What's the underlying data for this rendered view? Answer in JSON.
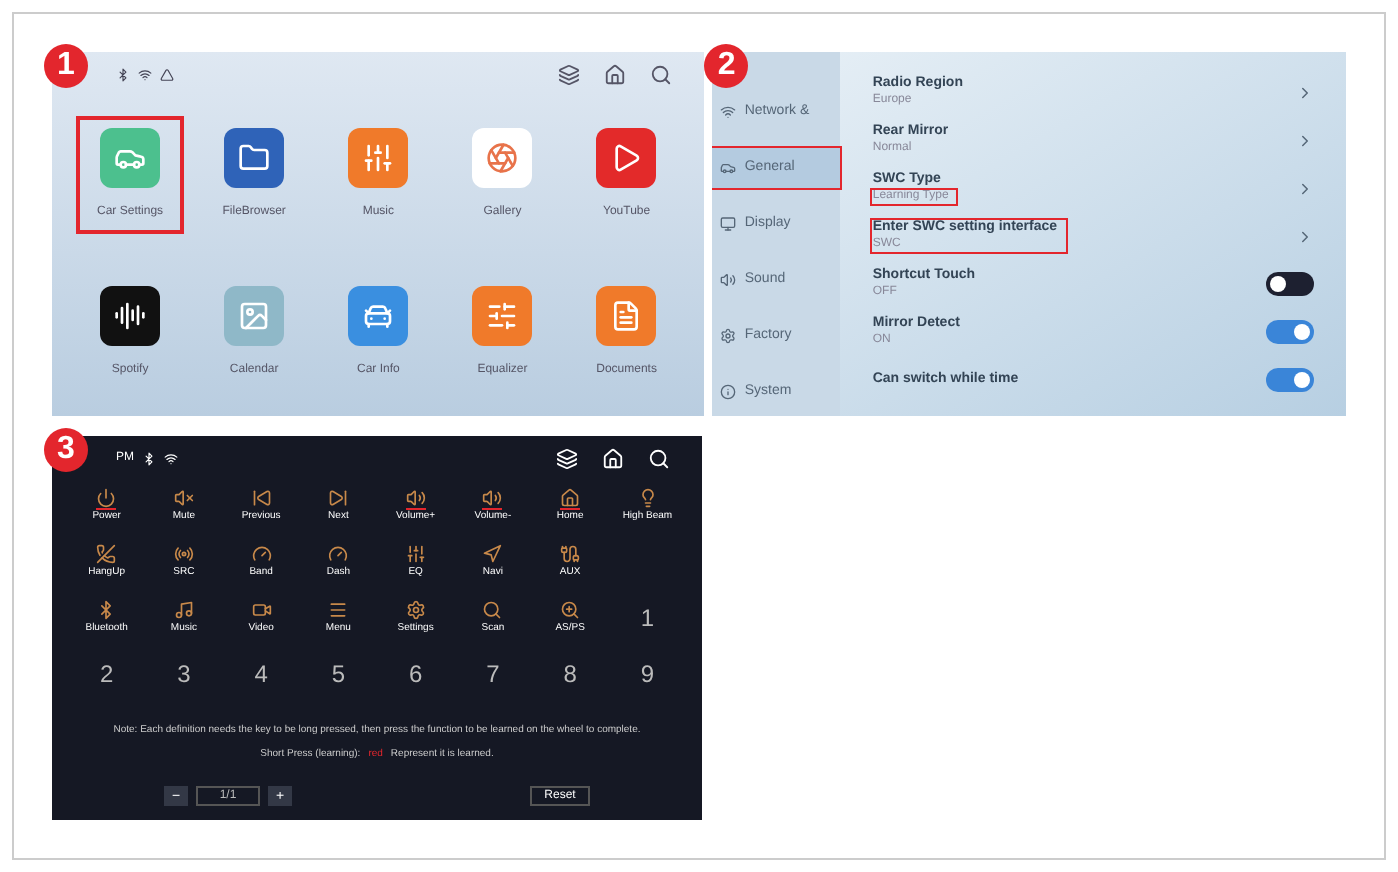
{
  "step_badges": [
    "1",
    "2",
    "3"
  ],
  "home_screen": {
    "apps": [
      {
        "label": "Car Settings",
        "color": "#4cc08e",
        "highlighted": true
      },
      {
        "label": "FileBrowser",
        "color": "#2f63b8",
        "highlighted": false
      },
      {
        "label": "Music",
        "color": "#f07a2a",
        "highlighted": false
      },
      {
        "label": "Gallery",
        "color": "#ffffff",
        "highlighted": false
      },
      {
        "label": "YouTube",
        "color": "#e32a2a",
        "highlighted": false
      },
      {
        "label": "Spotify",
        "color": "#111111",
        "highlighted": false
      },
      {
        "label": "Calendar",
        "color": "#8fb8c8",
        "highlighted": false
      },
      {
        "label": "Car Info",
        "color": "#3a8fe0",
        "highlighted": false
      },
      {
        "label": "Equalizer",
        "color": "#f07a2a",
        "highlighted": false
      },
      {
        "label": "Documents",
        "color": "#f07a2a",
        "highlighted": false
      }
    ]
  },
  "settings_screen": {
    "sidebar": [
      {
        "label": "Network &",
        "selected": false
      },
      {
        "label": "General",
        "selected": true
      },
      {
        "label": "Display",
        "selected": false
      },
      {
        "label": "Sound",
        "selected": false
      },
      {
        "label": "Factory",
        "selected": false
      },
      {
        "label": "System",
        "selected": false
      }
    ],
    "rows": [
      {
        "kind": "link",
        "title": "Radio Region",
        "value": "Europe",
        "row_highlighted": false,
        "value_highlighted": false
      },
      {
        "kind": "link",
        "title": "Rear Mirror",
        "value": "Normal",
        "row_highlighted": false,
        "value_highlighted": false
      },
      {
        "kind": "link",
        "title": "SWC Type",
        "value": "Learning Type",
        "row_highlighted": false,
        "value_highlighted": true
      },
      {
        "kind": "link",
        "title": "Enter SWC setting interface",
        "value": "SWC",
        "row_highlighted": true,
        "value_highlighted": false
      },
      {
        "kind": "toggle",
        "title": "Shortcut Touch",
        "value": "OFF",
        "on": false,
        "row_highlighted": false,
        "value_highlighted": false
      },
      {
        "kind": "toggle",
        "title": "Mirror Detect",
        "value": "ON",
        "on": true,
        "row_highlighted": false,
        "value_highlighted": false
      },
      {
        "kind": "toggle",
        "title": "Can switch while time",
        "on": true,
        "row_highlighted": false
      }
    ]
  },
  "swc_screen": {
    "time": "PM",
    "keys": [
      {
        "kind": "icon",
        "label": "Power",
        "learned": true
      },
      {
        "kind": "icon",
        "label": "Mute",
        "learned": false
      },
      {
        "kind": "icon",
        "label": "Previous",
        "learned": false
      },
      {
        "kind": "icon",
        "label": "Next",
        "learned": false
      },
      {
        "kind": "icon",
        "label": "Volume+",
        "learned": true
      },
      {
        "kind": "icon",
        "label": "Volume-",
        "learned": true
      },
      {
        "kind": "icon",
        "label": "Home",
        "learned": true
      },
      {
        "kind": "icon",
        "label": "High Beam",
        "learned": false
      },
      {
        "kind": "icon",
        "label": "HangUp",
        "learned": false
      },
      {
        "kind": "icon",
        "label": "SRC",
        "learned": false
      },
      {
        "kind": "icon",
        "label": "Band",
        "learned": false
      },
      {
        "kind": "icon",
        "label": "Dash",
        "learned": false
      },
      {
        "kind": "icon",
        "label": "EQ",
        "learned": false
      },
      {
        "kind": "icon",
        "label": "Navi",
        "learned": false
      },
      {
        "kind": "icon",
        "label": "AUX",
        "learned": false
      },
      {
        "kind": "blank"
      },
      {
        "kind": "icon",
        "label": "Bluetooth",
        "learned": false
      },
      {
        "kind": "icon",
        "label": "Music",
        "learned": false
      },
      {
        "kind": "icon",
        "label": "Video",
        "learned": false
      },
      {
        "kind": "icon",
        "label": "Menu",
        "learned": false
      },
      {
        "kind": "icon",
        "label": "Settings",
        "learned": false
      },
      {
        "kind": "icon",
        "label": "Scan",
        "learned": false
      },
      {
        "kind": "icon",
        "label": "AS/PS",
        "learned": false
      },
      {
        "kind": "number",
        "label": "1"
      },
      {
        "kind": "number",
        "label": "2"
      },
      {
        "kind": "number",
        "label": "3"
      },
      {
        "kind": "number",
        "label": "4"
      },
      {
        "kind": "number",
        "label": "5"
      },
      {
        "kind": "number",
        "label": "6"
      },
      {
        "kind": "number",
        "label": "7"
      },
      {
        "kind": "number",
        "label": "8"
      },
      {
        "kind": "number",
        "label": "9"
      }
    ],
    "note": "Note: Each definition needs the key to be long pressed, then press the function to be learned on the wheel to complete.",
    "note_2_before": "Short Press (learning):",
    "note_2_mark": "red",
    "note_2_after": "Represent it is learned.",
    "minus": "−",
    "page": "1/1",
    "plus": "+",
    "reset": "Reset"
  }
}
